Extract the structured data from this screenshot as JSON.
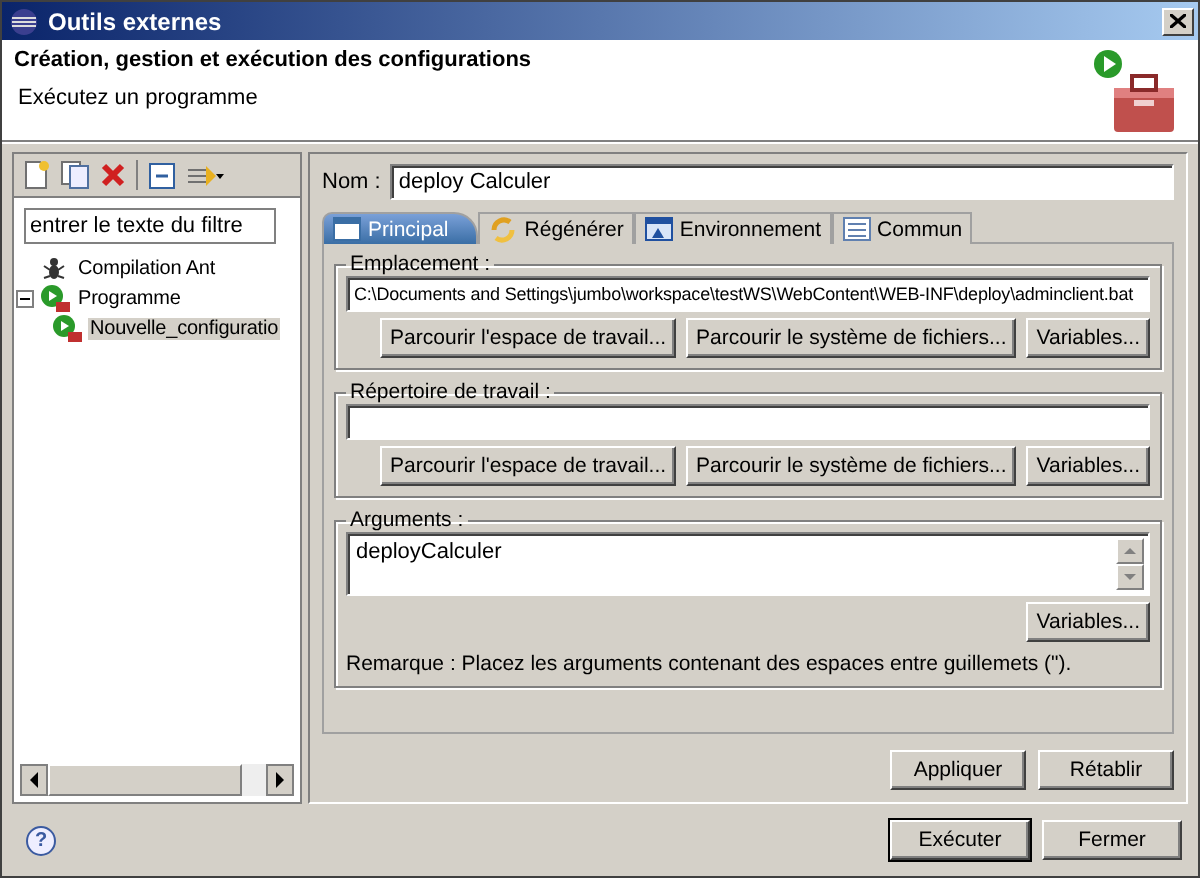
{
  "window": {
    "title": "Outils externes"
  },
  "header": {
    "title": "Création, gestion et exécution des configurations",
    "message": "Exécutez un programme"
  },
  "filter": {
    "value": "entrer le texte du filtre"
  },
  "tree": [
    {
      "label": "Compilation Ant",
      "kind": "ant",
      "selected": false
    },
    {
      "label": "Programme",
      "kind": "program",
      "expanded": true,
      "selected": false,
      "children": [
        {
          "label": "Nouvelle_configuratio",
          "kind": "config",
          "selected": true
        }
      ]
    }
  ],
  "name": {
    "label": "Nom :",
    "value": "deploy Calculer"
  },
  "tabs": [
    {
      "label": "Principal",
      "kind": "main",
      "selected": true
    },
    {
      "label": "Régénérer",
      "kind": "refresh",
      "selected": false
    },
    {
      "label": "Environnement",
      "kind": "env",
      "selected": false
    },
    {
      "label": "Commun",
      "kind": "common",
      "selected": false
    }
  ],
  "groups": [
    {
      "title": "Emplacement :",
      "kind": "line",
      "value": "C:\\Documents and Settings\\jumbo\\workspace\\testWS\\WebContent\\WEB-INF\\deploy\\adminclient.bat",
      "buttons": [
        "Parcourir l'espace de travail...",
        "Parcourir le système de fichiers...",
        "Variables..."
      ]
    },
    {
      "title": "Répertoire de travail :",
      "kind": "line",
      "buttons": [
        "Parcourir l'espace de travail...",
        "Parcourir le système de fichiers...",
        "Variables..."
      ]
    },
    {
      "title": "Arguments :",
      "kind": "multiline",
      "value": "deployCalculer",
      "buttons": [
        "Variables..."
      ],
      "note": "Remarque : Placez les arguments contenant des espaces entre guillemets (\")."
    }
  ],
  "form_buttons": [
    "Appliquer",
    "Rétablir"
  ],
  "help": {
    "glyph": "?"
  },
  "dialog_buttons": [
    {
      "label": "Exécuter",
      "default": true
    },
    {
      "label": "Fermer",
      "default": false
    }
  ]
}
